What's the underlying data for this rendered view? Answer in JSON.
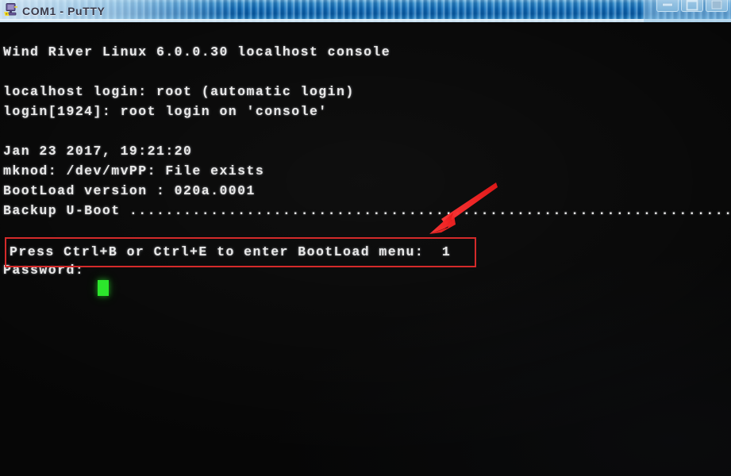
{
  "window": {
    "title": "COM1 - PuTTY",
    "icon": "putty-icon",
    "controls": {
      "minimize_label": "Minimize",
      "maximize_label": "Maximize",
      "close_label": "Close"
    }
  },
  "terminal": {
    "background_color": "#060606",
    "foreground_color": "#e8e8e8",
    "cursor_color": "#2ce62c",
    "cursor_visible": true,
    "lines": [
      "",
      "Wind River Linux 6.0.0.30 localhost console",
      "",
      "localhost login: root (automatic login)",
      "login[1924]: root login on 'console'",
      "",
      "Jan 23 2017, 19:21:20",
      "mknod: /dev/mvPP: File exists",
      "BootLoad version : 020a.0001",
      "Backup U-Boot ..................................................................."
    ],
    "highlighted_line": "Press Ctrl+B or Ctrl+E to enter BootLoad menu:  1",
    "prompt_line": "Password:"
  },
  "annotations": {
    "box_color": "#d42a2a",
    "arrow_color": "#f22424",
    "arrow_from": "625,233",
    "arrow_to": "543,292",
    "box_target": "Press Ctrl+B or Ctrl+E to enter BootLoad menu:  1"
  }
}
